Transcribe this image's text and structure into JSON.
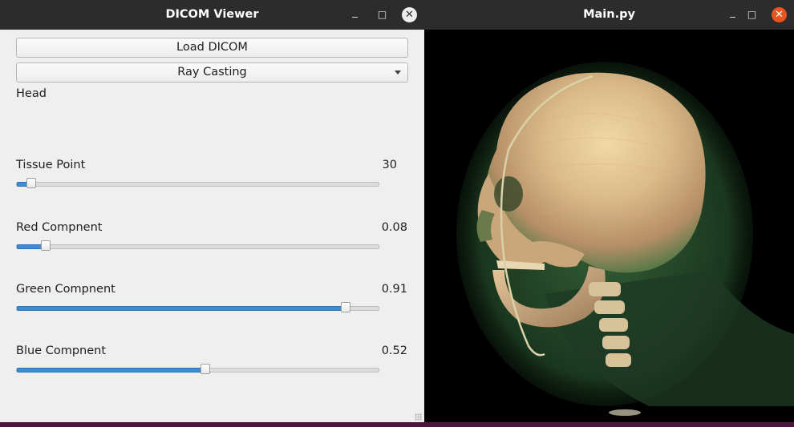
{
  "left_window": {
    "title": "DICOM Viewer",
    "load_button": "Load DICOM",
    "render_mode": "Ray Casting",
    "dataset_label": "Head",
    "sliders": [
      {
        "label": "Tissue Point",
        "value": "30",
        "level": 0.04
      },
      {
        "label": "Red Compnent",
        "value": "0.08",
        "level": 0.08
      },
      {
        "label": "Green Compnent",
        "value": "0.91",
        "level": 0.91
      },
      {
        "label": "Blue Compnent",
        "value": "0.52",
        "level": 0.52
      }
    ]
  },
  "right_window": {
    "title": "Main.py"
  },
  "icons": {
    "minimize": "minimize-icon",
    "maximize": "maximize-icon",
    "close": "close-icon"
  },
  "colors": {
    "titlebar": "#2c2c2c",
    "close_active": "#e95420",
    "slider_fill": "#3b8ed6",
    "render_background": "#000000"
  }
}
